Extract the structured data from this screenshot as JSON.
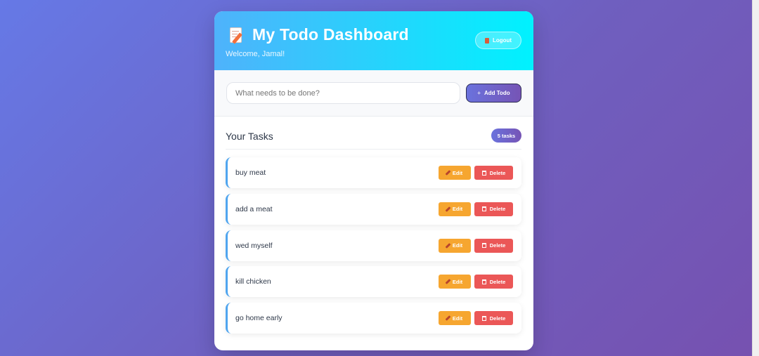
{
  "header": {
    "title": "My Todo Dashboard",
    "welcome": "Welcome, Jamal!",
    "logout_label": "Logout"
  },
  "add_todo": {
    "placeholder": "What needs to be done?",
    "value": "",
    "button_label": "Add Todo"
  },
  "tasks_section": {
    "title": "Your Tasks",
    "count_badge": "5 tasks"
  },
  "tasks": [
    {
      "text": "buy meat",
      "edit_label": "Edit",
      "delete_label": "Delete"
    },
    {
      "text": "add a meat",
      "edit_label": "Edit",
      "delete_label": "Delete"
    },
    {
      "text": "wed myself",
      "edit_label": "Edit",
      "delete_label": "Delete"
    },
    {
      "text": "kill chicken",
      "edit_label": "Edit",
      "delete_label": "Delete"
    },
    {
      "text": "go home early",
      "edit_label": "Edit",
      "delete_label": "Delete"
    }
  ],
  "icons": {
    "title": "memo-icon",
    "logout": "door-icon",
    "add": "plus-icon",
    "edit": "pencil-icon",
    "delete": "trash-icon"
  },
  "colors": {
    "header_gradient_start": "#4fb2fb",
    "header_gradient_end": "#00f2fe",
    "accent_start": "#6a72dd",
    "accent_end": "#7654b5",
    "edit": "#f6a630",
    "delete": "#eb5757",
    "task_border": "#4fa5ef"
  }
}
